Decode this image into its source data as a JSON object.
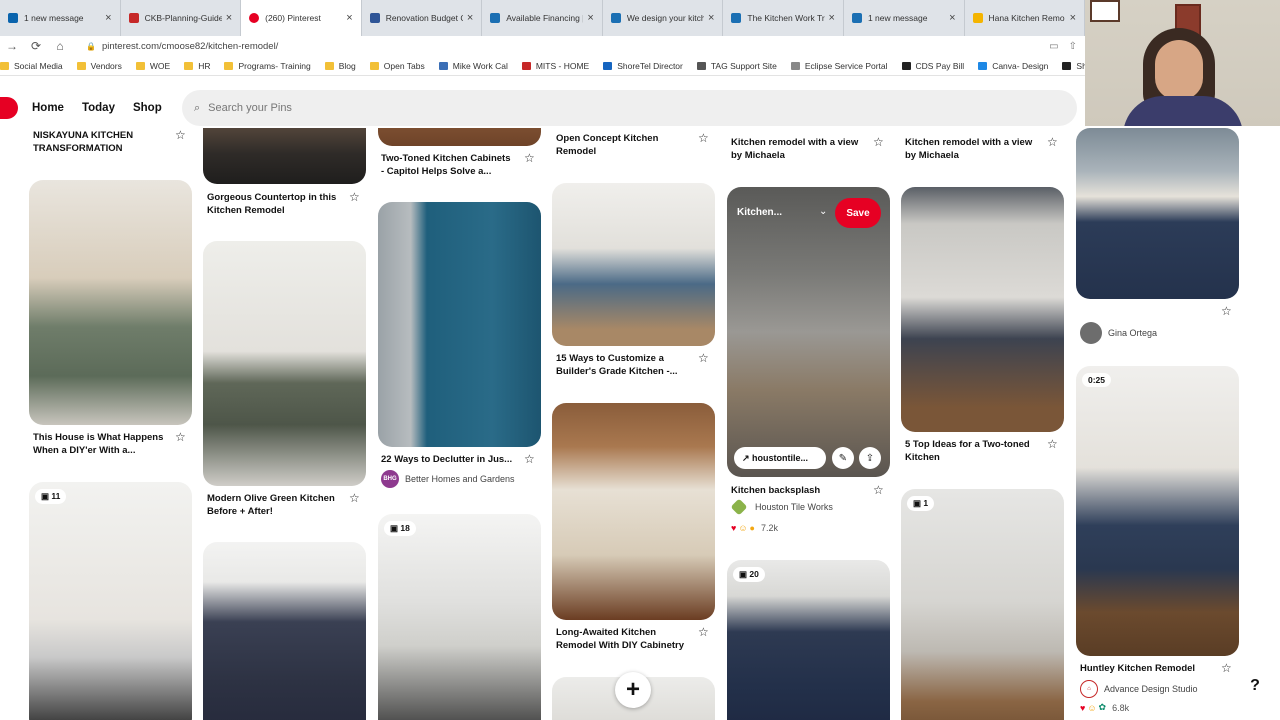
{
  "tabs": [
    {
      "title": "1 new message",
      "icon": "outlook-icon",
      "active": false
    },
    {
      "title": "CKB-Planning-Guide-",
      "icon": "pdf-icon",
      "active": false
    },
    {
      "title": "(260) Pinterest",
      "icon": "pinterest-icon",
      "active": true
    },
    {
      "title": "Renovation Budget Ca",
      "icon": "sheet-icon",
      "active": false
    },
    {
      "title": "Available Financing | C",
      "icon": "site-icon",
      "active": false
    },
    {
      "title": "We design your kitche",
      "icon": "site-icon",
      "active": false
    },
    {
      "title": "The Kitchen Work Tria",
      "icon": "site-icon",
      "active": false
    },
    {
      "title": "1 new message",
      "icon": "site-icon",
      "active": false
    },
    {
      "title": "Hana Kitchen Remo",
      "icon": "drive-icon",
      "active": false
    }
  ],
  "address": {
    "url": "pinterest.com/cmoose82/kitchen-remodel/"
  },
  "bookmarks": [
    {
      "label": "Social Media",
      "color": "#f2c037"
    },
    {
      "label": "Vendors",
      "color": "#f2c037"
    },
    {
      "label": "WOE",
      "color": "#f2c037"
    },
    {
      "label": "HR",
      "color": "#f2c037"
    },
    {
      "label": "Programs- Training",
      "color": "#f2c037"
    },
    {
      "label": "Blog",
      "color": "#f2c037"
    },
    {
      "label": "Open Tabs",
      "color": "#f2c037"
    },
    {
      "label": "Mike Work Cal",
      "color": "#3b6fb6"
    },
    {
      "label": "MITS - HOME",
      "color": "#c62828"
    },
    {
      "label": "ShoreTel Director",
      "color": "#1565c0"
    },
    {
      "label": "TAG Support Site",
      "color": "#555555"
    },
    {
      "label": "Eclipse Service Portal",
      "color": "#888888"
    },
    {
      "label": "CDS Pay Bill",
      "color": "#222222"
    },
    {
      "label": "Canva- Design",
      "color": "#1e88e5"
    },
    {
      "label": "ShoreTel Comm",
      "color": "#222222"
    }
  ],
  "pinterest": {
    "nav": {
      "home": "Home",
      "today": "Today",
      "shop": "Shop"
    },
    "search_placeholder": "Search your Pins"
  },
  "pins": {
    "p1": {
      "title": "NISKAYUNA KITCHEN\nTRANSFORMATION"
    },
    "p2": {
      "title": "This House is What Happens\nWhen a DIY'er With a..."
    },
    "p3": {
      "count": "11"
    },
    "p4": {
      "title": "Gorgeous Countertop in this\nKitchen Remodel"
    },
    "p5": {
      "title": "Modern Olive Green Kitchen\nBefore + After!"
    },
    "p6": {
      "title": "Two-Toned Kitchen Cabinets\n- Capitol Helps Solve a..."
    },
    "p7": {
      "title": "22 Ways to Declutter in Jus...",
      "source": "Better Homes and Gardens",
      "source_abbr": "BHG"
    },
    "p8": {
      "count": "18"
    },
    "p9": {
      "title": "Open Concept Kitchen\nRemodel"
    },
    "p10": {
      "title": "15 Ways to Customize a\nBuilder's Grade Kitchen -..."
    },
    "p11": {
      "title": "Long-Awaited Kitchen\nRemodel With DIY Cabinetry"
    },
    "p12": {
      "title": "Kitchen remodel with a view\nby Michaela"
    },
    "p13": {
      "overlay_title": "Kitchen...",
      "save": "Save",
      "link": "houstontile...",
      "title": "Kitchen backsplash",
      "source": "Houston Tile Works",
      "reactions": "7.2k"
    },
    "p14": {
      "count": "20"
    },
    "p15": {
      "title": "Kitchen remodel with a view\nby Michaela"
    },
    "p16": {
      "title": "5 Top Ideas for a Two-toned\nKitchen"
    },
    "p17": {
      "count": "1"
    },
    "p18": {
      "source": "Gina Ortega"
    },
    "p19": {
      "duration": "0:25",
      "title": "Huntley Kitchen Remodel",
      "source": "Advance Design Studio",
      "reactions": "6.8k"
    }
  },
  "fab": {
    "label": "+"
  },
  "help": {
    "label": "?"
  }
}
